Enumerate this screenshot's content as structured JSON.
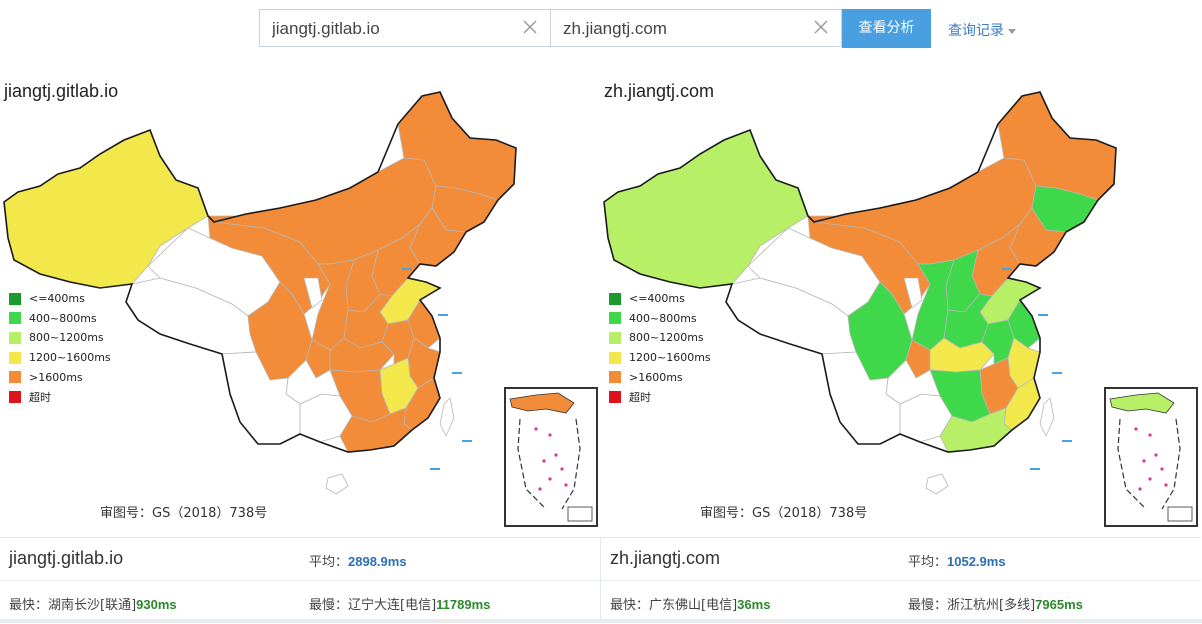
{
  "search": {
    "site_a": "jiangtj.gitlab.io",
    "site_b": "zh.jiangtj.com",
    "analyze_label": "查看分析",
    "history_label": "查询记录"
  },
  "legend": [
    {
      "label": "<=400ms",
      "color": "#1a9b2c"
    },
    {
      "label": "400~800ms",
      "color": "#3fd84a"
    },
    {
      "label": "800~1200ms",
      "color": "#b7f066"
    },
    {
      "label": "1200~1600ms",
      "color": "#f2e84b"
    },
    {
      "label": ">1600ms",
      "color": "#f28c38"
    },
    {
      "label": "超时",
      "color": "#e0121b"
    }
  ],
  "approval_text": "审图号：GS（2018）738号",
  "panels": [
    {
      "title": "jiangtj.gitlab.io",
      "avg_label": "平均：",
      "avg_value": "2898.9ms",
      "fastest_label": "最快：",
      "fastest_place": "湖南长沙[联通]",
      "fastest_value": "930ms",
      "slowest_label": "最慢：",
      "slowest_place": "辽宁大连[电信]",
      "slowest_value": "11789ms"
    },
    {
      "title": "zh.jiangtj.com",
      "avg_label": "平均：",
      "avg_value": "1052.9ms",
      "fastest_label": "最快：",
      "fastest_place": "广东佛山[电信]",
      "fastest_value": "36ms",
      "slowest_label": "最慢：",
      "slowest_place": "浙江杭州[多线]",
      "slowest_value": "7965ms"
    }
  ],
  "regions": [
    "xinjiang",
    "tibet",
    "qinghai",
    "gansu",
    "neimenggu",
    "heilongjiang",
    "jilin",
    "liaoning",
    "hebei",
    "shanxi",
    "shaanxi",
    "ningxia",
    "shandong",
    "henan",
    "sichuan",
    "chongqing",
    "hubei",
    "anhui",
    "jiangsu",
    "zhejiang",
    "jiangxi",
    "hunan",
    "fujian",
    "guangdong",
    "guangxi",
    "guizhou",
    "yunnan",
    "hainan",
    "taiwan"
  ],
  "region_colors": {
    "a": {
      "xinjiang": "#f2e84b",
      "tibet": "#ffffff",
      "qinghai": "#ffffff",
      "gansu": "#f28c38",
      "neimenggu": "#f28c38",
      "heilongjiang": "#f28c38",
      "jilin": "#f28c38",
      "liaoning": "#f28c38",
      "hebei": "#f28c38",
      "shanxi": "#f28c38",
      "shaanxi": "#f28c38",
      "ningxia": "#ffffff",
      "shandong": "#f2e84b",
      "henan": "#f28c38",
      "sichuan": "#f28c38",
      "chongqing": "#f28c38",
      "hubei": "#f28c38",
      "anhui": "#f28c38",
      "jiangsu": "#f28c38",
      "zhejiang": "#f28c38",
      "jiangxi": "#f2e84b",
      "hunan": "#f28c38",
      "fujian": "#f28c38",
      "guangdong": "#f28c38",
      "guangxi": "#ffffff",
      "guizhou": "#ffffff",
      "yunnan": "#ffffff",
      "hainan": "#ffffff",
      "taiwan": "#ffffff"
    },
    "b": {
      "xinjiang": "#b7f066",
      "tibet": "#ffffff",
      "qinghai": "#ffffff",
      "gansu": "#f28c38",
      "neimenggu": "#f28c38",
      "heilongjiang": "#f28c38",
      "jilin": "#3fd84a",
      "liaoning": "#f28c38",
      "hebei": "#f28c38",
      "shanxi": "#3fd84a",
      "shaanxi": "#3fd84a",
      "ningxia": "#ffffff",
      "shandong": "#b7f066",
      "henan": "#3fd84a",
      "sichuan": "#3fd84a",
      "chongqing": "#f28c38",
      "hubei": "#f2e84b",
      "anhui": "#3fd84a",
      "jiangsu": "#3fd84a",
      "zhejiang": "#f2e84b",
      "jiangxi": "#f28c38",
      "hunan": "#3fd84a",
      "fujian": "#f2e84b",
      "guangdong": "#b7f066",
      "guangxi": "#ffffff",
      "guizhou": "#ffffff",
      "yunnan": "#ffffff",
      "hainan": "#ffffff",
      "taiwan": "#ffffff"
    }
  }
}
